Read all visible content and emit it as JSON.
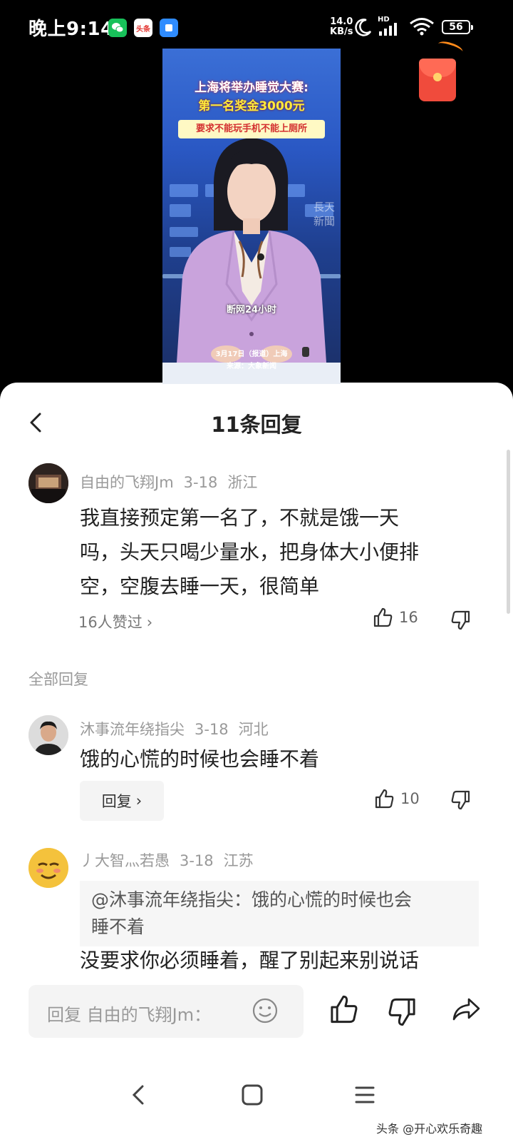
{
  "status_bar": {
    "time": "晚上9:14",
    "app_badge_toutiao": "头条",
    "network_speed_value": "14.0",
    "network_speed_unit": "KB/s",
    "signal_label": "HD",
    "battery": "56"
  },
  "video": {
    "headline_line1": "上海将举办睡觉大赛:",
    "headline_line2": "第一名奖金3000元",
    "headline_line3": "要求不能玩手机不能上厕所",
    "station_watermark": "長天新聞",
    "subtitle": "断网24小时",
    "info_line1": "3月17日（报道）上海",
    "info_line2": "来源：大象新闻"
  },
  "sheet": {
    "title": "11条回复"
  },
  "main_comment": {
    "author": "自由的飞翔Jm",
    "date": "3-18",
    "location": "浙江",
    "text_line1": "我直接预定第一名了，不就是饿一天",
    "text_line2": "吗，头天只喝少量水，把身体大小便排",
    "text_line3": "空，空腹去睡一天，很简单",
    "liked_by": "16人赞过",
    "like_count": "16"
  },
  "all_replies_label": "全部回复",
  "replies": [
    {
      "author": "沐事流年绕指尖",
      "date": "3-18",
      "location": "河北",
      "text": "饿的心慌的时候也会睡不着",
      "reply_label": "回复",
      "like_count": "10"
    },
    {
      "author": "丿大智灬若愚",
      "date": "3-18",
      "location": "江苏",
      "quote_line1": "@沐事流年绕指尖：饿的心慌的时候也会",
      "quote_line2": "睡不着",
      "text": "没要求你必须睡着，醒了别起来别说话"
    }
  ],
  "input_bar": {
    "placeholder": "回复 自由的飞翔Jm："
  },
  "watermark": "头条 @开心欢乐奇趣",
  "colors": {
    "sheet_bg": "#ffffff",
    "meta_text": "#999999",
    "body_text": "#222222",
    "red_packet": "#f04b3c"
  }
}
